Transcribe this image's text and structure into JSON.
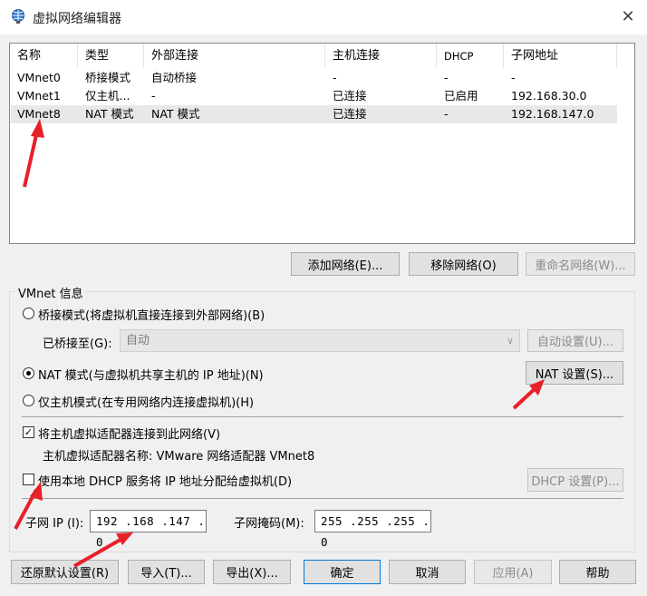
{
  "window": {
    "title": "虚拟网络编辑器",
    "close_glyph": "✕"
  },
  "table": {
    "headers": [
      "名称",
      "类型",
      "外部连接",
      "主机连接",
      "DHCP",
      "子网地址"
    ],
    "rows": [
      [
        "VMnet0",
        "桥接模式",
        "自动桥接",
        "-",
        "-",
        "-"
      ],
      [
        "VMnet1",
        "仅主机...",
        "-",
        "已连接",
        "已启用",
        "192.168.30.0"
      ],
      [
        "VMnet8",
        "NAT 模式",
        "NAT 模式",
        "已连接",
        "-",
        "192.168.147.0"
      ]
    ],
    "selected_index": 2
  },
  "list_buttons": {
    "add": "添加网络(E)...",
    "remove": "移除网络(O)",
    "rename": "重命名网络(W)..."
  },
  "vmnet_info": {
    "title": "VMnet 信息",
    "bridged_label": "桥接模式(将虚拟机直接连接到外部网络)(B)",
    "bridged_to_label": "已桥接至(G):",
    "bridged_to_value": "自动",
    "auto_settings": "自动设置(U)...",
    "nat_label": "NAT 模式(与虚拟机共享主机的 IP 地址)(N)",
    "nat_settings": "NAT 设置(S)...",
    "hostonly_label": "仅主机模式(在专用网络内连接虚拟机)(H)",
    "selected_mode": "nat",
    "connect_adapter_label": "将主机虚拟适配器连接到此网络(V)",
    "connect_adapter_checked": true,
    "adapter_name_label": "主机虚拟适配器名称: VMware 网络适配器 VMnet8",
    "dhcp_label": "使用本地 DHCP 服务将 IP 地址分配给虚拟机(D)",
    "dhcp_checked": false,
    "dhcp_settings": "DHCP 设置(P)...",
    "subnet_ip_label": "子网 IP (I):",
    "subnet_ip": "192 .168 .147 .  0",
    "subnet_mask_label": "子网掩码(M):",
    "subnet_mask": "255 .255 .255 .  0"
  },
  "footer_buttons": {
    "restore": "还原默认设置(R)",
    "import": "导入(T)...",
    "export": "导出(X)...",
    "ok": "确定",
    "cancel": "取消",
    "apply": "应用(A)",
    "help": "帮助"
  },
  "colors": {
    "annotation_arrow": "#e8202a",
    "focus_border": "#0078d7"
  }
}
